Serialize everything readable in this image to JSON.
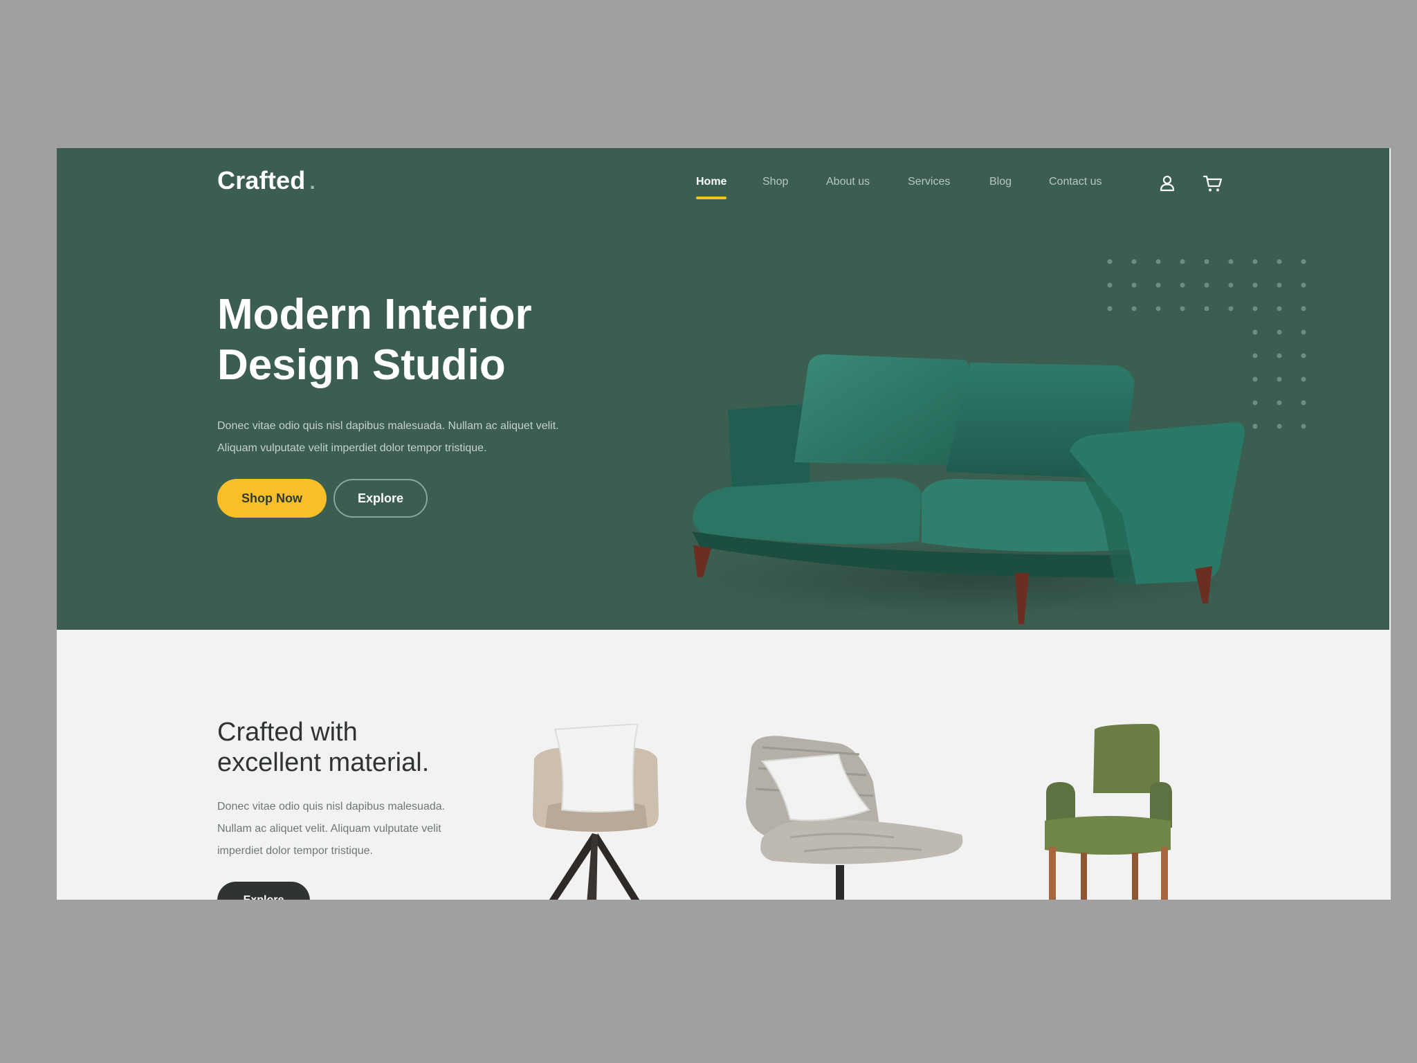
{
  "brand": {
    "name": "Crafted",
    "dot": "."
  },
  "nav": {
    "items": [
      {
        "label": "Home",
        "active": true
      },
      {
        "label": "Shop",
        "active": false
      },
      {
        "label": "About us",
        "active": false
      },
      {
        "label": "Services",
        "active": false
      },
      {
        "label": "Blog",
        "active": false
      },
      {
        "label": "Contact us",
        "active": false
      }
    ],
    "icons": [
      "user-icon",
      "cart-icon"
    ]
  },
  "hero": {
    "title": "Modern Interior\nDesign Studio",
    "description": "Donec vitae odio quis nisl dapibus malesuada. Nullam ac aliquet velit. Aliquam vulputate velit imperdiet dolor tempor tristique.",
    "primary_button": "Shop Now",
    "secondary_button": "Explore",
    "image": "green-velvet-sofa"
  },
  "material_section": {
    "title": "Crafted with\nexcellent material.",
    "description": "Donec vitae odio quis nisl dapibus malesuada. Nullam ac aliquet velit. Aliquam vulputate velit imperdiet dolor tempor tristique.",
    "button": "Explore",
    "products": [
      "beige-armchair",
      "grey-lounge-chair",
      "olive-dining-chair"
    ]
  },
  "colors": {
    "hero_bg": "#3c5e51",
    "accent": "#f9bf29",
    "page_bg": "#f1f2f1",
    "outer_bg": "#a0a0a0",
    "dark": "#2f3432"
  }
}
